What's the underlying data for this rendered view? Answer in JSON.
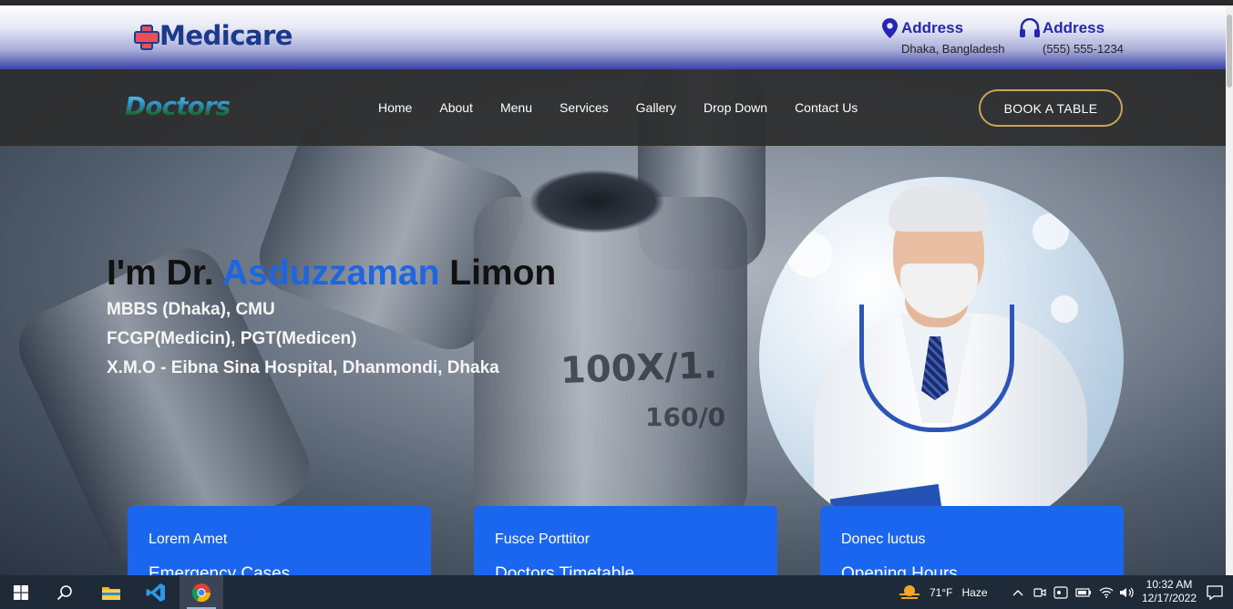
{
  "topbar": {
    "brand": "Medicare",
    "address1": {
      "title": "Address",
      "detail": "Dhaka, Bangladesh"
    },
    "address2": {
      "title": "Address",
      "detail": "(555) 555-1234"
    }
  },
  "nav": {
    "logo": "Doctors",
    "links": [
      "Home",
      "About",
      "Menu",
      "Services",
      "Gallery",
      "Drop Down",
      "Contact Us"
    ],
    "book_button": "BOOK A TABLE"
  },
  "hero": {
    "title_prefix": "I'm Dr. ",
    "title_accent": "Asduzzaman",
    "title_suffix": " Limon",
    "lines": [
      "MBBS (Dhaka), CMU",
      "FCGP(Medicin), PGT(Medicen)",
      "X.M.O - Eibna Sina Hospital, Dhanmondi, Dhaka"
    ],
    "image_text": [
      "100X/1.",
      "160/0"
    ],
    "accent_color": "#1e66e0"
  },
  "cards": [
    {
      "label": "Lorem Amet",
      "title": "Emergency Cases"
    },
    {
      "label": "Fusce Porttitor",
      "title": "Doctors Timetable"
    },
    {
      "label": "Donec luctus",
      "title": "Opening Hours"
    }
  ],
  "card_color": "#1a66ef",
  "taskbar": {
    "weather_temp": "71°F",
    "weather_desc": "Haze",
    "time": "10:32 AM",
    "date": "12/17/2022",
    "pinned_icons": [
      "windows-start-icon",
      "search-icon",
      "file-explorer-icon",
      "vscode-icon",
      "chrome-icon"
    ]
  }
}
